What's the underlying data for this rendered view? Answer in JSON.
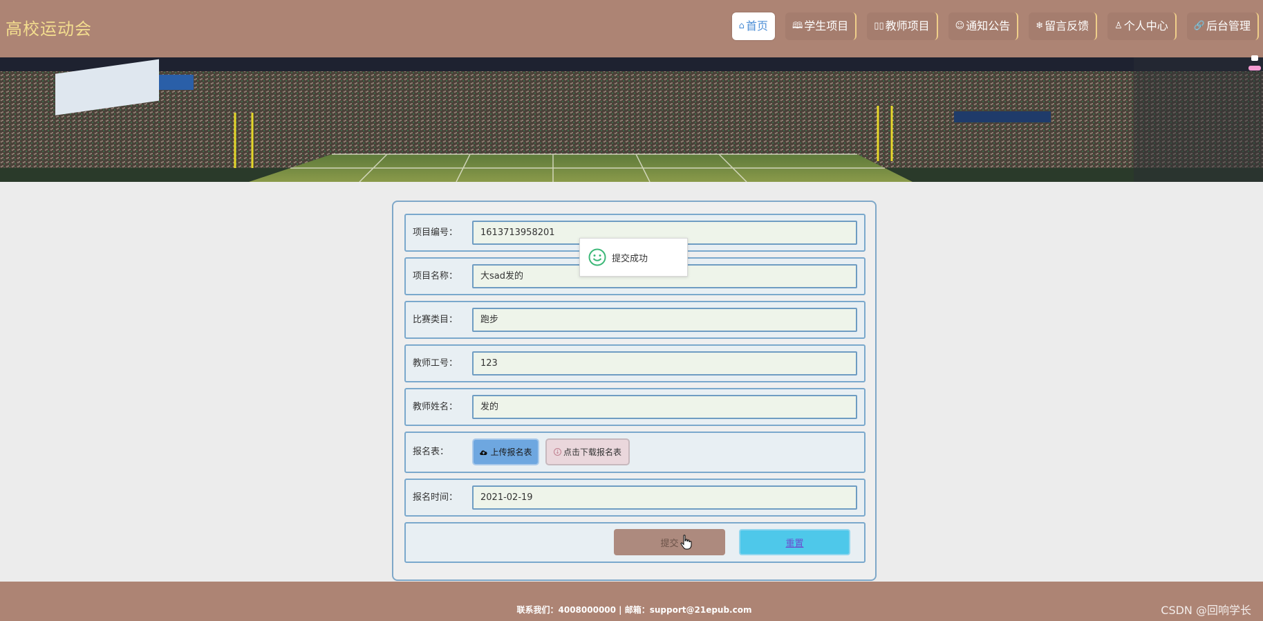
{
  "header": {
    "logo": "高校运动会",
    "nav": [
      {
        "icon": "⌂",
        "label": "首页",
        "active": true
      },
      {
        "icon": "🕮",
        "label": "学生项目"
      },
      {
        "icon": "▯▯",
        "label": "教师项目"
      },
      {
        "icon": "☺",
        "label": "通知公告"
      },
      {
        "icon": "❄",
        "label": "留言反馈"
      },
      {
        "icon": "♙",
        "label": "个人中心"
      },
      {
        "icon": "🔗",
        "label": "后台管理"
      }
    ]
  },
  "form": {
    "fields": [
      {
        "label": "项目编号：",
        "value": "1613713958201"
      },
      {
        "label": "项目名称：",
        "value": "大sad发的"
      },
      {
        "label": "比赛类目：",
        "value": "跑步"
      },
      {
        "label": "教师工号：",
        "value": "123"
      },
      {
        "label": "教师姓名：",
        "value": "发的"
      }
    ],
    "upload": {
      "label": "报名表：",
      "upload_button": "上传报名表",
      "download_button": "点击下载报名表"
    },
    "date": {
      "label": "报名时间：",
      "value": "2021-02-19"
    },
    "submit_label": "提交",
    "reset_label": "重置"
  },
  "toast": {
    "message": "提交成功"
  },
  "footer": {
    "contact": "联系我们：4008000000 | 邮箱：support@21epub.com",
    "watermark": "CSDN @回响学长"
  },
  "colors": {
    "header_bg": "#ad8474",
    "logo": "#f3dd8e",
    "accent_blue": "#4ec8ea",
    "submit_bg": "#ad8a7e"
  }
}
